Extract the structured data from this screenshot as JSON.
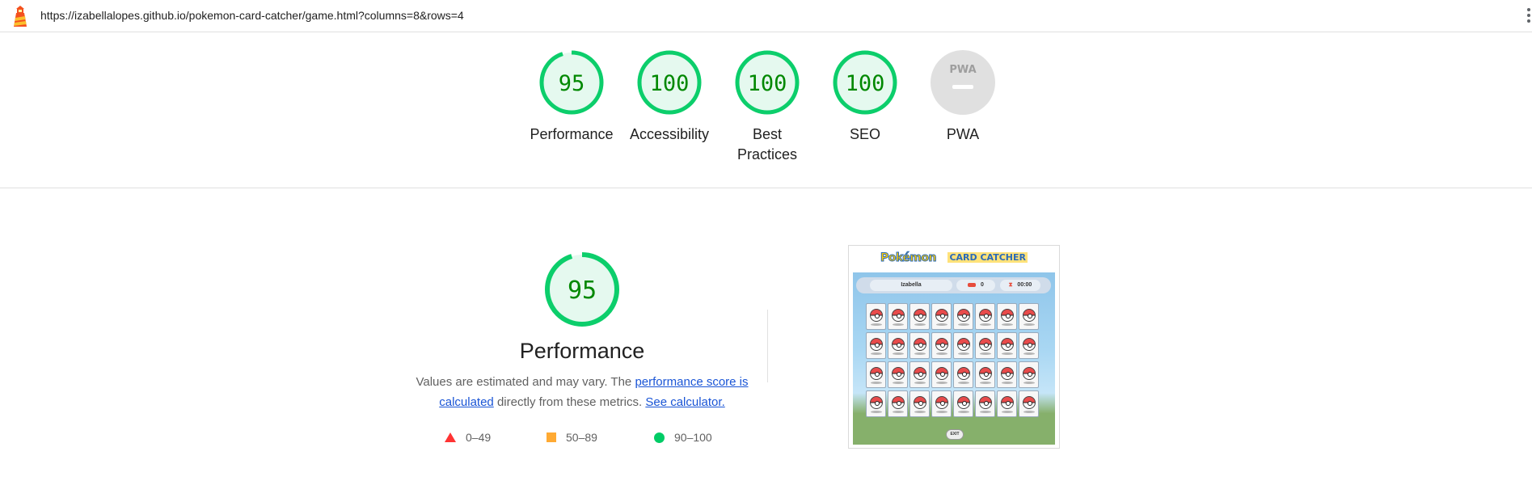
{
  "browser": {
    "url": "https://izabellalopes.github.io/pokemon-card-catcher/game.html?columns=8&rows=4",
    "logo_icon": "lighthouse-icon",
    "menu_icon": "more-vert-icon"
  },
  "summary": {
    "gauges": [
      {
        "label": "Performance",
        "score": "95"
      },
      {
        "label": "Accessibility",
        "score": "100"
      },
      {
        "label": "Best Practices",
        "score": "100"
      },
      {
        "label": "SEO",
        "score": "100"
      },
      {
        "label": "PWA",
        "score": "PWA"
      }
    ],
    "colors": {
      "pass": "#0cce6b",
      "pass_fill": "#e5f9ef",
      "pass_text": "#008800",
      "na": "#e0e0e0"
    }
  },
  "performance": {
    "score": "95",
    "title": "Performance",
    "desc_prefix": "Values are estimated and may vary. The",
    "desc_link": "performance score is calculated",
    "desc_mid": "directly from these metrics.",
    "desc_link2": "See calculator.",
    "legend": [
      {
        "range": "0–49",
        "color": "#ff3333",
        "shape": "triangle"
      },
      {
        "range": "50–89",
        "color": "#ffaa33",
        "shape": "square"
      },
      {
        "range": "90–100",
        "color": "#00cc66",
        "shape": "circle"
      }
    ]
  },
  "thumbnail": {
    "logo": "Pokémon",
    "subtitle": "CARD CATCHER",
    "player": "Izabella",
    "moves": "0",
    "time": "00:00",
    "exit": "EXIT",
    "columns": 8,
    "rows": 4
  }
}
